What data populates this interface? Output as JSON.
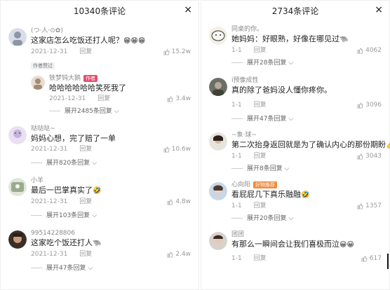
{
  "left_panel": {
    "title": "10340条评论",
    "close": "×",
    "c1": {
      "name": "(つ·人·⊙✿)",
      "text": "这家店怎么吃饭还打人呢？",
      "emoji": "😁😁😁",
      "date": "2021-12-31",
      "reply": "回复",
      "likes": "15.2w",
      "tag": "作者赞过"
    },
    "c1_reply": {
      "name": "铁梦钝大鹅",
      "badge": "作者",
      "text": "哈哈哈哈哈哈笑死我了",
      "date": "2021-12-31",
      "reply": "回复",
      "likes": "3.4w"
    },
    "c1_expand": "展开2485条回复",
    "c2": {
      "name": "哒哒哒~",
      "text": "妈妈心想，完了赔了一单",
      "date": "2021-12-31",
      "reply": "回复",
      "likes": "10.6w"
    },
    "c2_expand": "展开820条回复",
    "c3": {
      "name": "小羊",
      "text": "最后一巴掌真实了",
      "emoji": "🤣",
      "date": "2021-12-31",
      "reply": "回复",
      "likes": "4.8w"
    },
    "c3_expand": "展开103条回复",
    "c4": {
      "name": "99514228806",
      "text": "这家吃个饭还打人",
      "emoji": "🐃",
      "date": "2021-12-31",
      "reply": "回复",
      "likes": "2.4w"
    },
    "c4_expand": "展开47条回复"
  },
  "right_panel": {
    "title": "2734条评论",
    "close": "×",
    "c1": {
      "name": "同桌的你。",
      "text": "她妈妈：好眼熟，好像在哪见过",
      "emoji": "🐃",
      "date": "1-1",
      "reply": "回复",
      "likes": "4062"
    },
    "c1_expand": "展开28条回复",
    "c2": {
      "name": "i预像成性",
      "text": "真的除了爸妈没人懂你疼你。",
      "date": "1-1",
      "reply": "回复",
      "likes": "3096"
    },
    "c2_expand": "展开47条回复",
    "c3": {
      "name": "~象·球~",
      "text": "第二次抬身返回就是为了确认内心的那份期盼",
      "emoji": "👍🥇",
      "date": "1-1",
      "reply": "回复",
      "likes": "3043"
    },
    "c3_expand": "展开8条回复",
    "c4": {
      "name": "心向阳",
      "badge_text": "好物推荐",
      "text": "看屁屁几下真乐融融",
      "emoji": "🤣",
      "date": "1-1",
      "reply": "回复",
      "likes": "1357"
    },
    "c4_expand": "展开20条回复",
    "c5": {
      "name": "团团",
      "text": "有那么一瞬间会让我们喜极而泣",
      "emoji": "😀😀",
      "date": "1-1",
      "reply": "回复",
      "likes": "617"
    }
  },
  "icons": {
    "like": "thumb-up-icon",
    "chevron": "chevron-down-icon",
    "close": "close-icon"
  },
  "colors": {
    "author_badge": "#e84c6d",
    "meta_gray": "#9a9a9a",
    "text": "#222222"
  }
}
